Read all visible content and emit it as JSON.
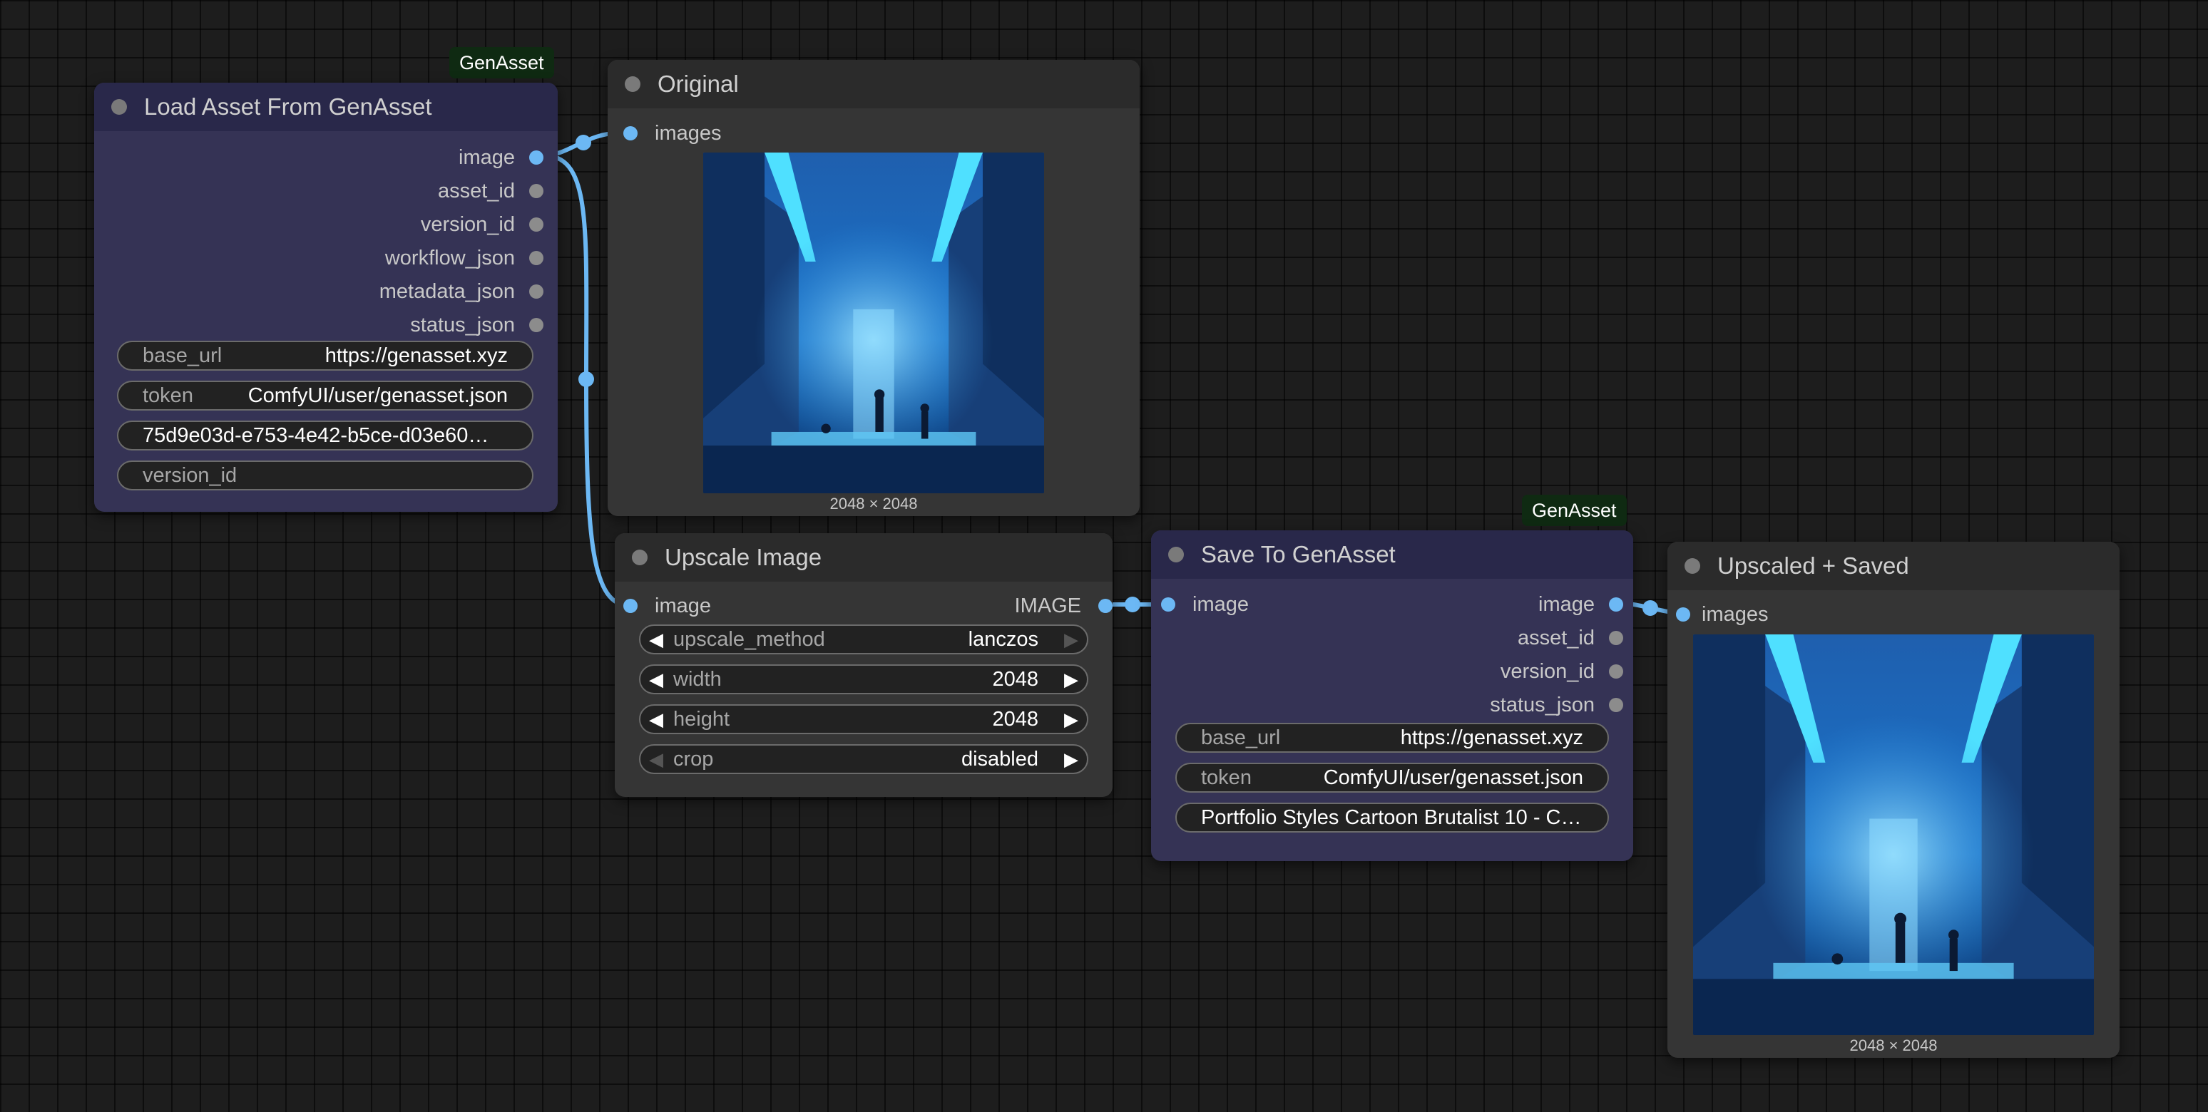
{
  "nodes": {
    "load": {
      "badge": "GenAsset",
      "title": "Load Asset From GenAsset",
      "outputs": [
        "image",
        "asset_id",
        "version_id",
        "workflow_json",
        "metadata_json",
        "status_json"
      ],
      "widgets": {
        "base_url": {
          "label": "base_url",
          "value": "https://genasset.xyz"
        },
        "token": {
          "label": "token",
          "value": "ComfyUI/user/genasset.json"
        },
        "asset_id_value": "75d9e03d-e753-4e42-b5ce-d03e60…",
        "version_id_placeholder": "version_id"
      }
    },
    "original": {
      "title": "Original",
      "input": "images",
      "image_size": "2048 × 2048"
    },
    "upscale": {
      "title": "Upscale Image",
      "input": "image",
      "output": "IMAGE",
      "widgets": [
        {
          "label": "upscale_method",
          "value": "lanczos"
        },
        {
          "label": "width",
          "value": "2048"
        },
        {
          "label": "height",
          "value": "2048"
        },
        {
          "label": "crop",
          "value": "disabled"
        }
      ]
    },
    "save": {
      "badge": "GenAsset",
      "title": "Save To GenAsset",
      "input": "image",
      "outputs": [
        "image",
        "asset_id",
        "version_id",
        "status_json"
      ],
      "widgets": {
        "base_url": {
          "label": "base_url",
          "value": "https://genasset.xyz"
        },
        "token": {
          "label": "token",
          "value": "ComfyUI/user/genasset.json"
        },
        "name_value": "Portfolio Styles Cartoon Brutalist 10 - C…"
      }
    },
    "upscaled": {
      "title": "Upscaled + Saved",
      "input": "images",
      "image_size": "2048 × 2048"
    }
  },
  "icons": {
    "arrow_left": "◀",
    "arrow_right": "▶"
  },
  "colors": {
    "link": "#6cb8f4",
    "port_image": "#6cb8f4",
    "port_default": "#8c8c8c",
    "badge_bg": "#0f2a12",
    "node_gray": "#353535",
    "node_purple": "#353355"
  }
}
